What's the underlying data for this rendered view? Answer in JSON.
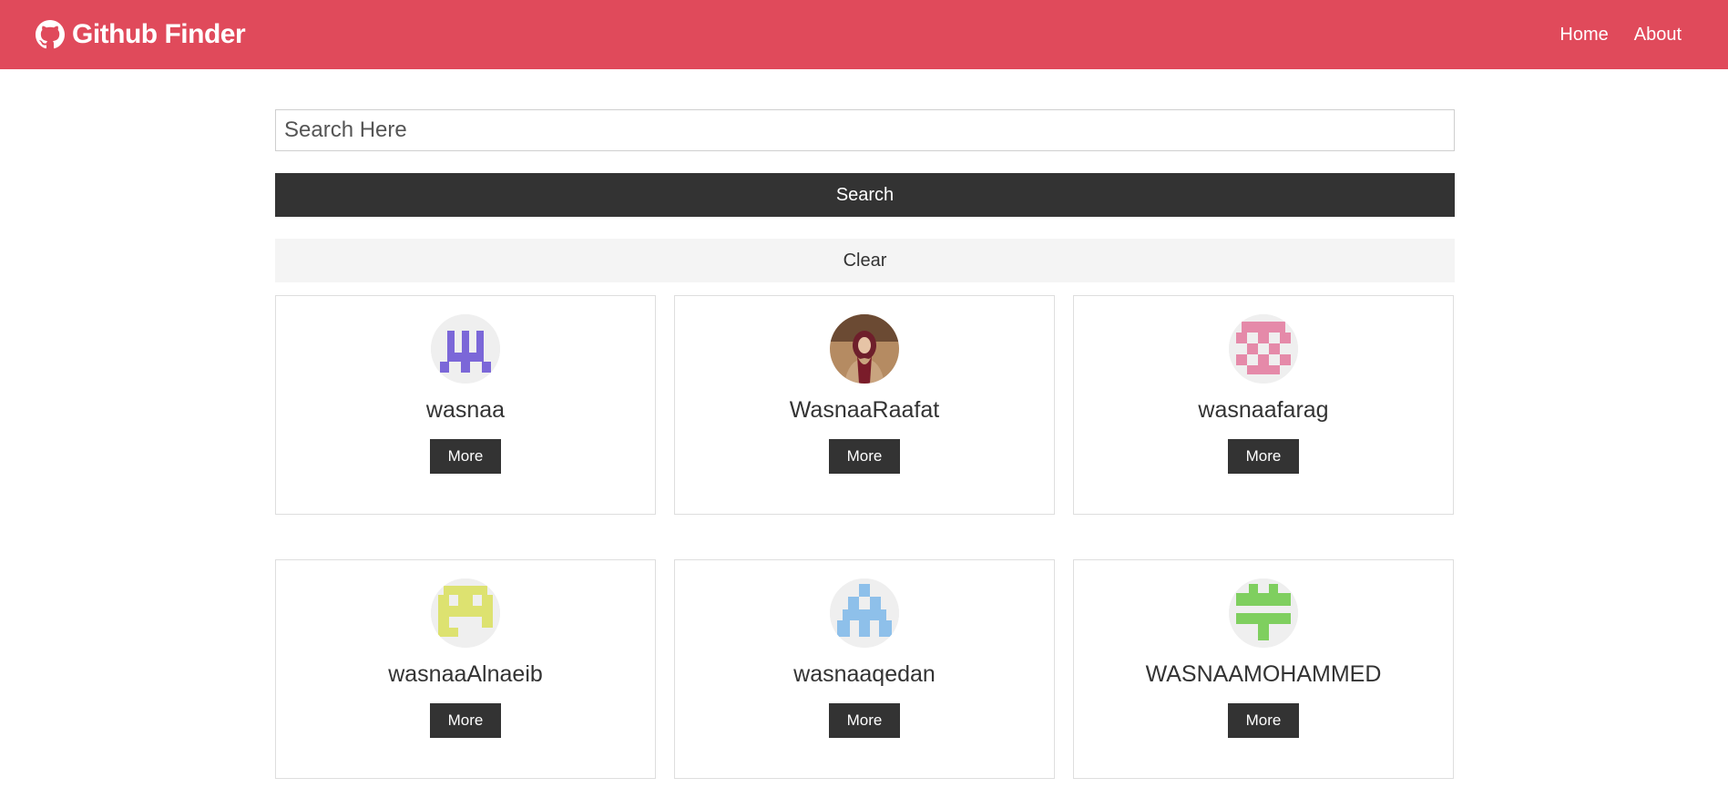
{
  "navbar": {
    "title": "Github Finder",
    "brand_icon": "github-icon",
    "bg_color": "#e04a5b",
    "links": [
      {
        "label": "Home"
      },
      {
        "label": "About"
      }
    ]
  },
  "search": {
    "placeholder": "Search Here",
    "value": "",
    "search_label": "Search",
    "clear_label": "Clear"
  },
  "users": [
    {
      "login": "wasnaa",
      "avatar": "identicon-purple",
      "more_label": "More"
    },
    {
      "login": "WasnaaRaafat",
      "avatar": "profile-photo",
      "more_label": "More"
    },
    {
      "login": "wasnaafarag",
      "avatar": "identicon-pink",
      "more_label": "More"
    },
    {
      "login": "wasnaaAlnaeib",
      "avatar": "identicon-yellow",
      "more_label": "More"
    },
    {
      "login": "wasnaaqedan",
      "avatar": "identicon-blue",
      "more_label": "More"
    },
    {
      "login": "WASNAAMOHAMMED",
      "avatar": "identicon-green",
      "more_label": "More"
    }
  ]
}
